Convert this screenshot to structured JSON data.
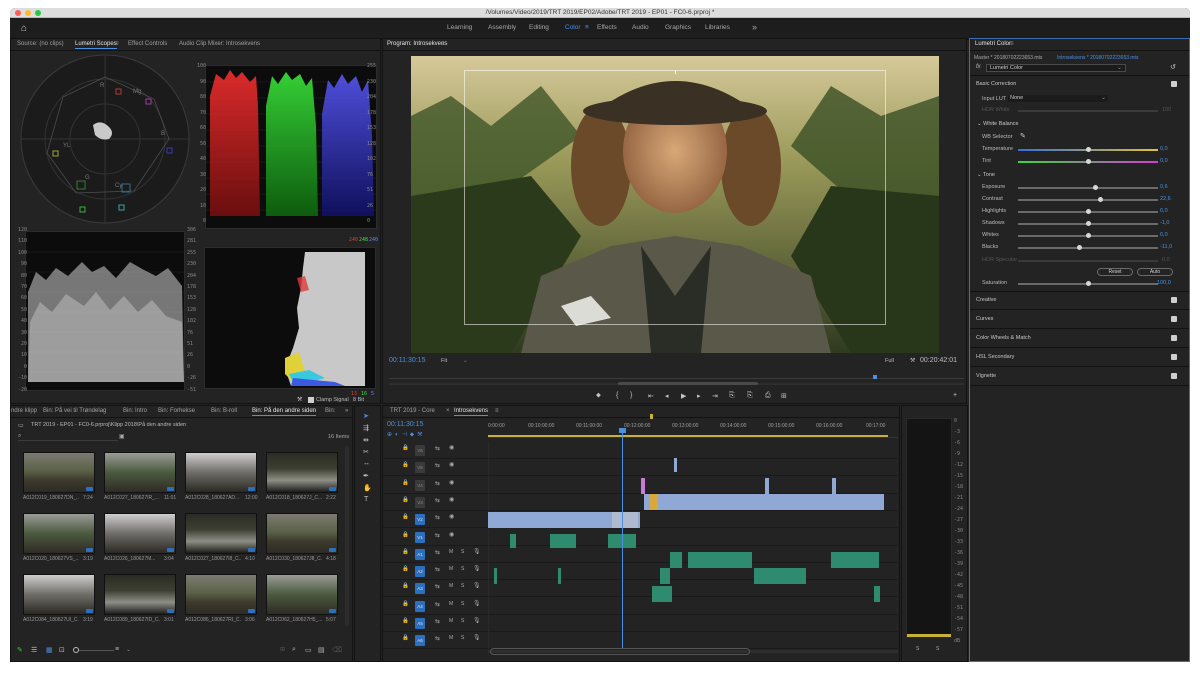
{
  "window": {
    "title": "/Volumes/Video/2019/TRT 2019/EP02/Adobe/TRT 2019 - EP01 - FC0-6.prproj *"
  },
  "workspaces": {
    "items": [
      "Learning",
      "Assembly",
      "Editing",
      "Color",
      "Effects",
      "Audio",
      "Graphics",
      "Libraries"
    ],
    "active": "Color",
    "more": "»"
  },
  "scopes_panel": {
    "tabs": [
      "Source: (no clips)",
      "Lumetri Scopes",
      "Effect Controls",
      "Audio Clip Mixer: Introsekvens"
    ],
    "active_tab": "Lumetri Scopes",
    "vector_labels": [
      "R",
      "Mg",
      "B",
      "Cy",
      "G",
      "YL"
    ],
    "parade_left": [
      "100",
      "90",
      "80",
      "70",
      "60",
      "50",
      "40",
      "30",
      "20",
      "10",
      "0"
    ],
    "parade_right": [
      "255",
      "230",
      "204",
      "178",
      "153",
      "128",
      "102",
      "76",
      "51",
      "26",
      "0"
    ],
    "wave_left": [
      "120",
      "110",
      "100",
      "90",
      "80",
      "70",
      "60",
      "50",
      "40",
      "30",
      "20",
      "10",
      "0",
      "-10",
      "-20"
    ],
    "wave_right": [
      "306",
      "281",
      "255",
      "230",
      "204",
      "178",
      "153",
      "128",
      "102",
      "76",
      "51",
      "26",
      "0",
      "-26",
      "-51"
    ],
    "rgb_top": [
      "240",
      "248",
      "240"
    ],
    "rgb_bottom": [
      "13",
      "16",
      "5"
    ],
    "clamp_label": "Clamp Signal",
    "bit_label": "8 Bit"
  },
  "program": {
    "title": "Program: Introsekvens",
    "timecode": "00:11:30:15",
    "fit": "Fit",
    "quality": "Full",
    "duration": "00:20:42:01",
    "transport": [
      "⬥",
      "{",
      "}",
      "⇤",
      "◂",
      "▶",
      "▸",
      "⇥",
      "⎘",
      "⎘",
      "⎙",
      "⊞",
      "+"
    ]
  },
  "lumetri": {
    "title": "Lumetri Color",
    "master_label": "Master * 20180702223653.mts",
    "seq_label": "Introsekvens * 20180702223653.mts",
    "fx_label": "Lumetri Color",
    "basic": "Basic Correction",
    "input_lut_label": "Input LUT",
    "input_lut_value": "None",
    "hdr_white": "HDR White",
    "hdr_white_val": "100",
    "white_balance": "White Balance",
    "wb_selector": "WB Selector",
    "tone": "Tone",
    "controls": [
      {
        "label": "Temperature",
        "value": "0,0"
      },
      {
        "label": "Tint",
        "value": "0,0"
      },
      {
        "label": "Exposure",
        "value": "0,6"
      },
      {
        "label": "Contrast",
        "value": "22,6"
      },
      {
        "label": "Highlights",
        "value": "0,0"
      },
      {
        "label": "Shadows",
        "value": "-1,0"
      },
      {
        "label": "Whites",
        "value": "0,0"
      },
      {
        "label": "Blacks",
        "value": "-11,0"
      }
    ],
    "control_levels": [
      0.5,
      0.5,
      0.55,
      0.59,
      0.5,
      0.5,
      0.5,
      0.44
    ],
    "hdr_specular": "HDR Specular",
    "hdr_specular_val": "0,0",
    "reset": "Reset",
    "auto": "Auto",
    "saturation_label": "Saturation",
    "saturation_value": "100,0",
    "sections": [
      "Creative",
      "Curves",
      "Color Wheels & Match",
      "HSL Secondary",
      "Vignette"
    ]
  },
  "project": {
    "tabs": [
      "ndre klipp",
      "Bin: På vei til Trøndelag",
      "Bin: Intro",
      "Bin: Forhekse",
      "Bin: B-roll",
      "Bin: På den andre siden",
      "Bin:"
    ],
    "active_tab": "Bin: På den andre siden",
    "path": "TRT 2019 - EP01 - FC0-6.prproj\\Klipp 2018\\På den andre siden",
    "count": "16 Items",
    "clips": [
      {
        "name": "A012C019_180627DN_...",
        "dur": "7:24"
      },
      {
        "name": "A012C027_180627IR_...",
        "dur": "11:01"
      },
      {
        "name": "A012C028_180627AD...",
        "dur": "12:00"
      },
      {
        "name": "A012C018_180627J_C...",
        "dur": "2:22"
      },
      {
        "name": "A012C020_180627VS_...",
        "dur": "3:19"
      },
      {
        "name": "A012C026_180627M...",
        "dur": "3:04"
      },
      {
        "name": "A012C027_180627I8_C...",
        "dur": "4:10"
      },
      {
        "name": "A012C030_180627J8_C...",
        "dur": "4:18"
      },
      {
        "name": "A012C084_180627UI_C...",
        "dur": "3:19"
      },
      {
        "name": "A012C089_180627ID_C...",
        "dur": "3:01"
      },
      {
        "name": "A012C086_180627RI_C...",
        "dur": "3:06"
      },
      {
        "name": "A012C062_180627H5_...",
        "dur": "5:07"
      }
    ]
  },
  "timeline": {
    "tabs": [
      "TRT 2019 - Core",
      "Introsekvens"
    ],
    "active_tab": "Introsekvens",
    "timecode": "00:11:30:15",
    "ruler": [
      "0:00:00",
      "00:10:00:00",
      "00:11:00:00",
      "00:12:00:00",
      "00:13:00:00",
      "00:14:00:00",
      "00:15:00:00",
      "00:16:00:00",
      "00:17:00"
    ],
    "tracks": [
      "V6",
      "V5",
      "V4",
      "V3",
      "V2",
      "V1",
      "A1",
      "A2",
      "A3",
      "A4",
      "A5",
      "A6"
    ]
  },
  "meter": {
    "scale": [
      "0",
      "-3",
      "-6",
      "-9",
      "-12",
      "-15",
      "-18",
      "-21",
      "-24",
      "-27",
      "-30",
      "-33",
      "-36",
      "-39",
      "-42",
      "-45",
      "-48",
      "-51",
      "-54",
      "-57",
      "dB"
    ],
    "bottom": [
      "S",
      "S"
    ]
  },
  "colors": {
    "accent": "#4a90e2",
    "clip_video": "#8fa8d6",
    "clip_audio": "#2e8b6e",
    "clip_pink": "#c77ad6"
  }
}
